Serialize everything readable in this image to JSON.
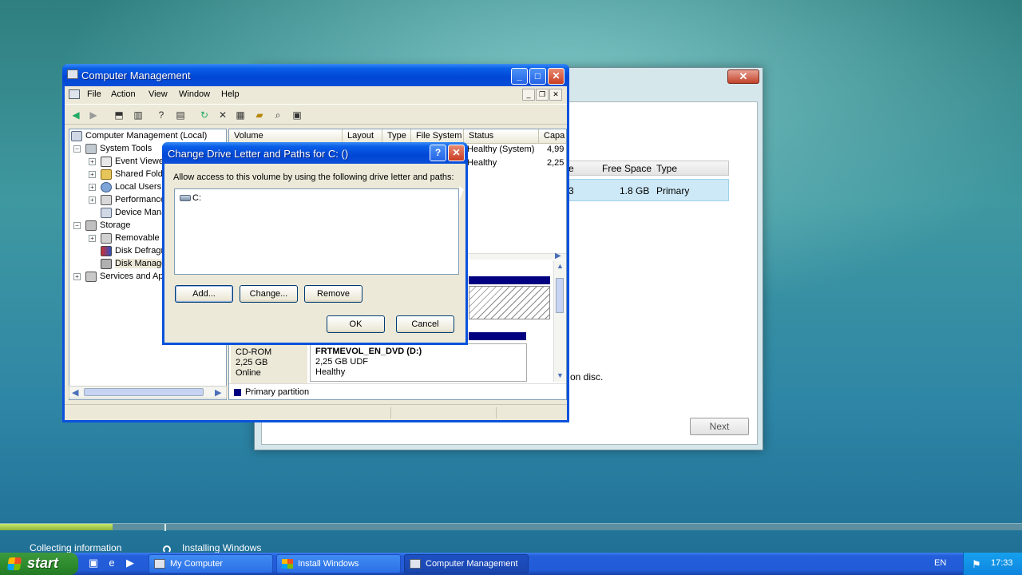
{
  "install_window": {
    "partition_table": {
      "headers": [
        "e",
        "Free Space",
        "Type"
      ],
      "row": [
        "3",
        "1.8 GB",
        "Primary"
      ]
    },
    "note": "on disc.",
    "next_label": "Next",
    "close_glyph": "✕"
  },
  "cm_window": {
    "title": "Computer Management",
    "menu": [
      "File",
      "Action",
      "View",
      "Window",
      "Help"
    ],
    "tree": {
      "root": "Computer Management (Local)",
      "system_tools": "System Tools",
      "system_tools_children": [
        "Event Viewe",
        "Shared Folde",
        "Local Users a",
        "Performance",
        "Device Mana"
      ],
      "storage": "Storage",
      "storage_children": [
        "Removable S",
        "Disk Defragn",
        "Disk Manage"
      ],
      "services": "Services and App"
    },
    "volume_columns": [
      "Volume",
      "Layout",
      "Type",
      "File System",
      "Status",
      "Capa"
    ],
    "volume_rows": [
      {
        "status": "Healthy (System)",
        "capacity": "4,99"
      },
      {
        "status": "Healthy",
        "capacity": "2,25"
      }
    ],
    "disk": {
      "type": "CD-ROM",
      "size": "2,25 GB",
      "state": "Online",
      "volume_name": "FRTMEVOL_EN_DVD  (D:)",
      "volume_fs": "2,25 GB UDF",
      "volume_status": "Healthy"
    },
    "legend": "Primary partition"
  },
  "dialog": {
    "title": "Change Drive Letter and Paths for C: ()",
    "instruction": "Allow access to this volume by using the following drive letter and paths:",
    "drive_entry": "C:",
    "add_label": "Add...",
    "change_label": "Change...",
    "remove_label": "Remove",
    "ok_label": "OK",
    "cancel_label": "Cancel"
  },
  "install_progress": {
    "fill_fraction": 0.11,
    "steps": [
      "Collecting information",
      "Installing Windows"
    ]
  },
  "taskbar": {
    "start_label": "start",
    "tasks": [
      "My Computer",
      "Install Windows",
      "Computer Management"
    ],
    "language": "EN",
    "clock": "17:33"
  },
  "colors": {
    "xp_blue": "#0a52dc",
    "primary_partition": "#000080",
    "progress_fill": "#8ab43a"
  }
}
